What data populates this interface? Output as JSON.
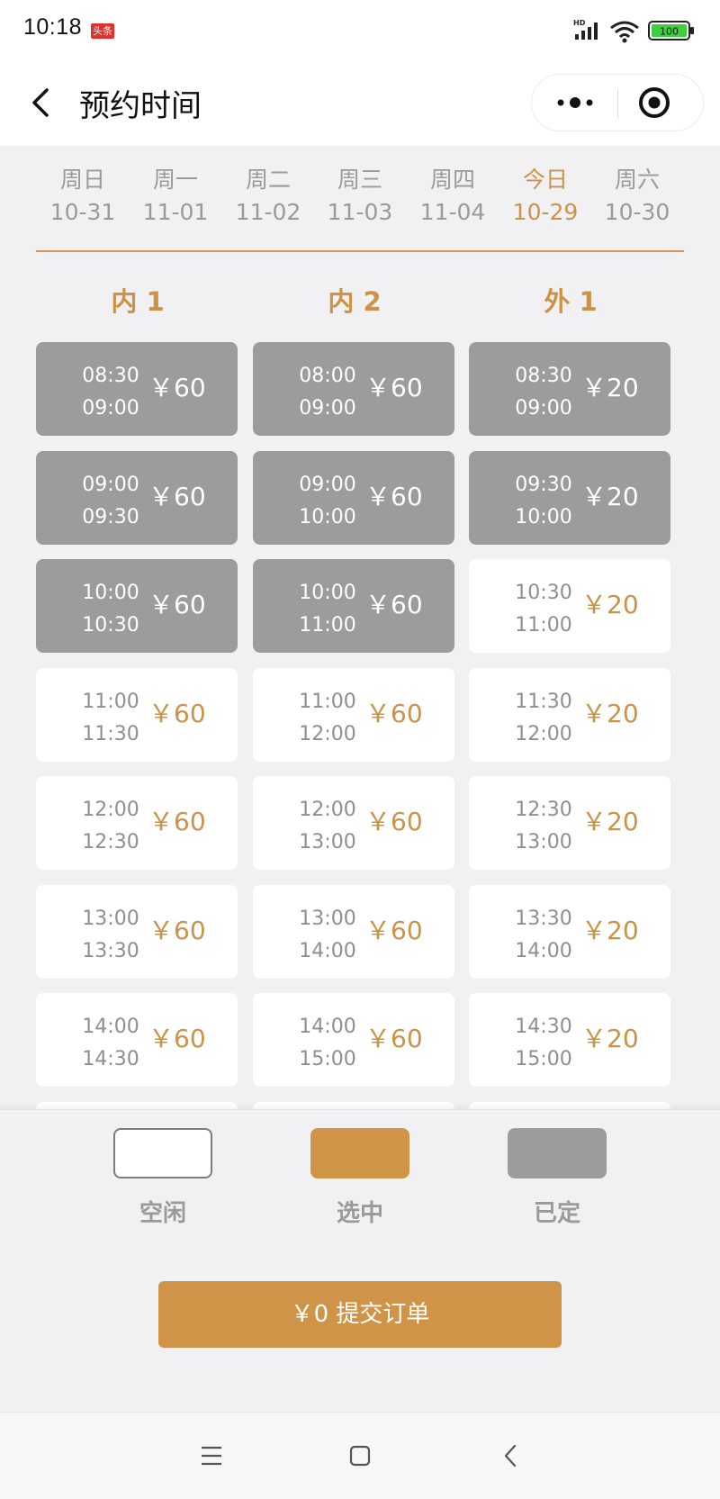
{
  "status_bar": {
    "time": "10:18",
    "app_badge": "头条",
    "network": "HD",
    "battery": "100"
  },
  "nav": {
    "title": "预约时间",
    "more_icon": "more-dots-icon",
    "close_icon": "target-circle-icon"
  },
  "days": [
    {
      "name": "周日",
      "date": "10-31",
      "active": false
    },
    {
      "name": "周一",
      "date": "11-01",
      "active": false
    },
    {
      "name": "周二",
      "date": "11-02",
      "active": false
    },
    {
      "name": "周三",
      "date": "11-03",
      "active": false
    },
    {
      "name": "周四",
      "date": "11-04",
      "active": false
    },
    {
      "name": "今日",
      "date": "10-29",
      "active": true
    },
    {
      "name": "周六",
      "date": "10-30",
      "active": false
    }
  ],
  "columns": [
    {
      "title": "内 1",
      "slots": [
        {
          "start": "08:30",
          "end": "09:00",
          "price": "￥60",
          "status": "booked"
        },
        {
          "start": "09:00",
          "end": "09:30",
          "price": "￥60",
          "status": "booked"
        },
        {
          "start": "10:00",
          "end": "10:30",
          "price": "￥60",
          "status": "booked"
        },
        {
          "start": "11:00",
          "end": "11:30",
          "price": "￥60",
          "status": "free"
        },
        {
          "start": "12:00",
          "end": "12:30",
          "price": "￥60",
          "status": "free"
        },
        {
          "start": "13:00",
          "end": "13:30",
          "price": "￥60",
          "status": "free"
        },
        {
          "start": "14:00",
          "end": "14:30",
          "price": "￥60",
          "status": "free"
        }
      ]
    },
    {
      "title": "内 2",
      "slots": [
        {
          "start": "08:00",
          "end": "09:00",
          "price": "￥60",
          "status": "booked"
        },
        {
          "start": "09:00",
          "end": "10:00",
          "price": "￥60",
          "status": "booked"
        },
        {
          "start": "10:00",
          "end": "11:00",
          "price": "￥60",
          "status": "booked"
        },
        {
          "start": "11:00",
          "end": "12:00",
          "price": "￥60",
          "status": "free"
        },
        {
          "start": "12:00",
          "end": "13:00",
          "price": "￥60",
          "status": "free"
        },
        {
          "start": "13:00",
          "end": "14:00",
          "price": "￥60",
          "status": "free"
        },
        {
          "start": "14:00",
          "end": "15:00",
          "price": "￥60",
          "status": "free"
        }
      ]
    },
    {
      "title": "外 1",
      "slots": [
        {
          "start": "08:30",
          "end": "09:00",
          "price": "￥20",
          "status": "booked"
        },
        {
          "start": "09:30",
          "end": "10:00",
          "price": "￥20",
          "status": "booked"
        },
        {
          "start": "10:30",
          "end": "11:00",
          "price": "￥20",
          "status": "free"
        },
        {
          "start": "11:30",
          "end": "12:00",
          "price": "￥20",
          "status": "free"
        },
        {
          "start": "12:30",
          "end": "13:00",
          "price": "￥20",
          "status": "free"
        },
        {
          "start": "13:30",
          "end": "14:00",
          "price": "￥20",
          "status": "free"
        },
        {
          "start": "14:30",
          "end": "15:00",
          "price": "￥20",
          "status": "free"
        }
      ]
    }
  ],
  "legend": [
    {
      "label": "空闲",
      "color": "#ffffff"
    },
    {
      "label": "选中",
      "color": "#cf9447"
    },
    {
      "label": "已定",
      "color": "#9c9c9c"
    }
  ],
  "submit": {
    "label": "￥0  提交订单"
  },
  "colors": {
    "accent": "#cf9447",
    "booked": "#9c9c9c",
    "free": "#ffffff"
  },
  "system_nav": [
    "menu-icon",
    "home-square-icon",
    "back-chevron-icon"
  ]
}
